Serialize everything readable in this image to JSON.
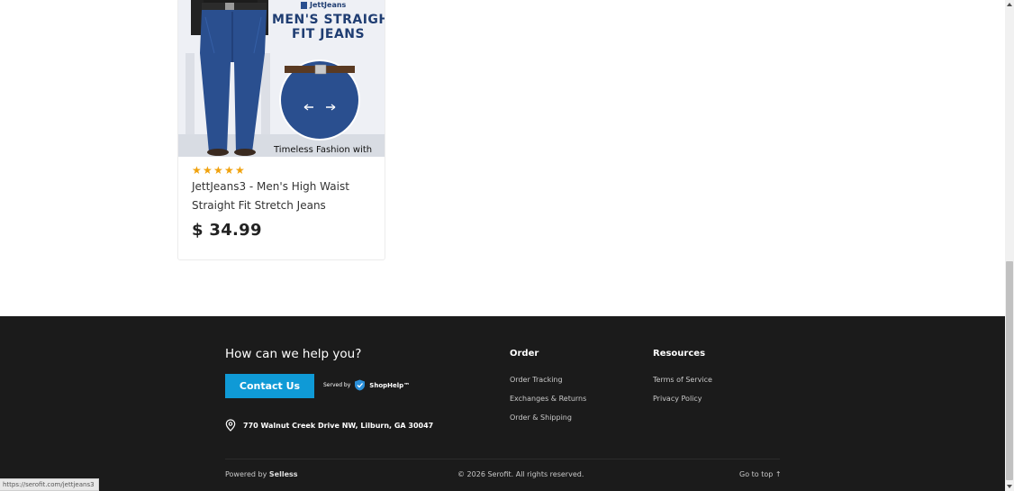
{
  "product": {
    "brand_logo": "JettJeans",
    "image_headline_1": "MEN'S STRAIGHT",
    "image_headline_2": "FIT JEANS",
    "image_caption": "Timeless Fashion with",
    "rating": 5,
    "rating_max": 5,
    "title": "JettJeans3 - Men's High Waist Straight Fit Stretch Jeans",
    "price": "$ 34.99"
  },
  "footer": {
    "help_title": "How can we help you?",
    "contact_button": "Contact Us",
    "served_by": "Served by",
    "shophelp": "ShopHelp™",
    "address": "770 Walnut Creek Drive NW, Lilburn, GA 30047",
    "order": {
      "title": "Order",
      "links": [
        "Order Tracking",
        "Exchanges & Returns",
        "Order & Shipping"
      ]
    },
    "resources": {
      "title": "Resources",
      "links": [
        "Terms of Service",
        "Privacy Policy"
      ]
    },
    "powered_prefix": "Powered by",
    "powered_brand": "Selless",
    "copyright": "© 2026 Serofit. All rights reserved.",
    "go_to_top": "Go to top ↑"
  },
  "status_bar": {
    "url": "https://serofit.com/jettjeans3"
  },
  "colors": {
    "star": "#f0a20d",
    "footer_bg": "#1b1b1b",
    "contact_button": "#0f9ad6",
    "jeans_blue": "#2a4f8f"
  }
}
